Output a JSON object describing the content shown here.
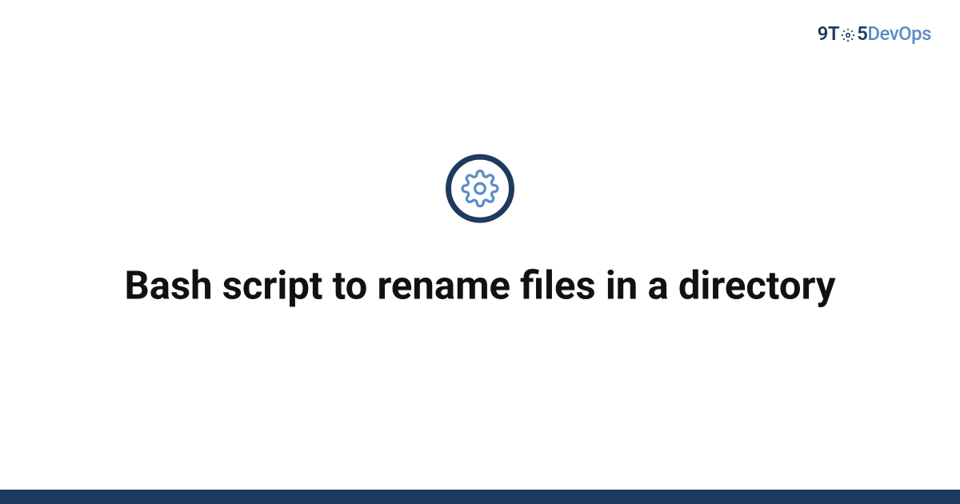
{
  "brand": {
    "part1": "9T",
    "part2": "5",
    "part3": "DevOps"
  },
  "title": "Bash script to rename files in a directory",
  "colors": {
    "dark_blue": "#1f3a5f",
    "light_blue": "#5b8dc5",
    "text": "#111111"
  }
}
